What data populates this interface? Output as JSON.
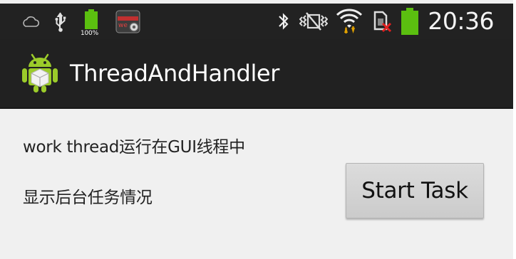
{
  "status_bar": {
    "left_icons": [
      "cloud-icon",
      "usb-icon",
      "battery-icon",
      "weather-app-icon"
    ],
    "battery_percent": "100%",
    "right_icons": [
      "bluetooth-icon",
      "vibrate-off-icon",
      "wifi-icon",
      "no-sim-icon",
      "battery-full-icon"
    ],
    "time": "20:36",
    "colors": {
      "background": "#222222",
      "battery": "#5bbf10",
      "wifi_arrows": "#e0a000"
    }
  },
  "action_bar": {
    "logo_icon": "android-robot-icon",
    "title": "ThreadAndHandler",
    "background": "#212121"
  },
  "content": {
    "line1": "work thread运行在GUI线程中",
    "line2": "显示后台任务情况",
    "start_button_label": "Start Task",
    "background": "#f0f0f0"
  }
}
